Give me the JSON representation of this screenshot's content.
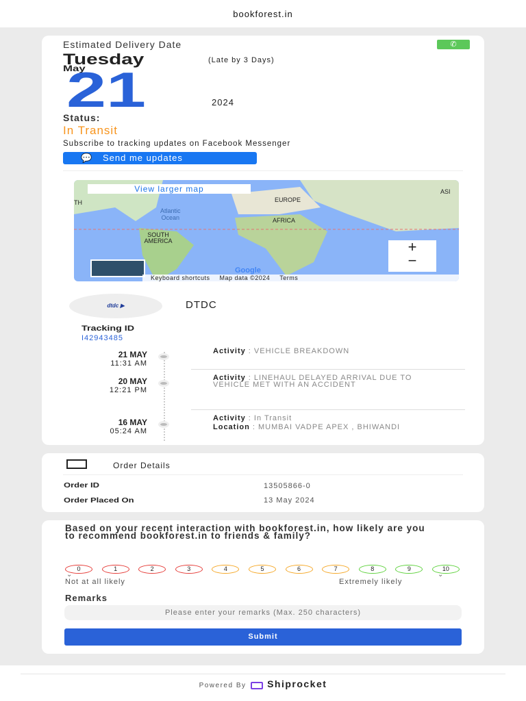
{
  "site": "bookforest.in",
  "delivery": {
    "label": "Estimated Delivery Date",
    "weekday": "Tuesday",
    "late": "(Late by 3 Days)",
    "month": "May",
    "day": "21",
    "year": "2024",
    "status_label": "Status:",
    "status": "In Transit",
    "subscribe_text": "Subscribe to tracking updates on Facebook Messenger",
    "send_button": "Send me updates",
    "whatsapp_icon": "whatsapp-icon"
  },
  "map": {
    "view_larger": "View larger map",
    "labels": {
      "atlantic": "Atlantic",
      "ocean": "Ocean",
      "europe": "EUROPE",
      "africa": "AFRICA",
      "south_america": "SOUTH AMERICA",
      "asia": "ASI",
      "north": "TH"
    },
    "google": "Google",
    "keyboard": "Keyboard shortcuts",
    "map_data": "Map data ©2024",
    "terms": "Terms",
    "zoom_in": "+",
    "zoom_out": "−"
  },
  "courier": {
    "logo_text": "DTDC",
    "name": "DTDC",
    "tracking_label": "Tracking ID",
    "tracking_id": "I42943485"
  },
  "timeline": [
    {
      "date": "21 MAY",
      "time": "11:31 AM",
      "activity_label": "Activity",
      "activity": "VEHICLE BREAKDOWN"
    },
    {
      "date": "20 MAY",
      "time": "12:21 PM",
      "activity_label": "Activity",
      "activity": "LINEHAUL DELAYED ARRIVAL DUE TO VEHICLE MET WITH AN ACCIDENT"
    },
    {
      "date": "16 MAY",
      "time": "05:24 AM",
      "activity_label": "Activity",
      "activity": "In Transit",
      "location_label": "Location",
      "location": "MUMBAI VADPE APEX , BHIWANDI"
    }
  ],
  "order": {
    "title": "Order Details",
    "id_label": "Order ID",
    "id": "13505866-0",
    "placed_label": "Order Placed On",
    "placed": "13 May 2024"
  },
  "nps": {
    "question": "Based on your recent interaction with bookforest.in, how likely are you to recommend bookforest.in to friends & family?",
    "scores": [
      "0",
      "1",
      "2",
      "3",
      "4",
      "5",
      "6",
      "7",
      "8",
      "9",
      "10"
    ],
    "colors": {
      "red": "#e53935",
      "orange": "#f5a623",
      "green": "#5cd13a"
    },
    "low": "Not at all likely",
    "high": "Extremely likely",
    "remarks_label": "Remarks",
    "remarks_placeholder": "Please enter your remarks (Max. 250 characters)",
    "submit": "Submit"
  },
  "footer": {
    "powered": "Powered By",
    "brand": "Shiprocket"
  }
}
